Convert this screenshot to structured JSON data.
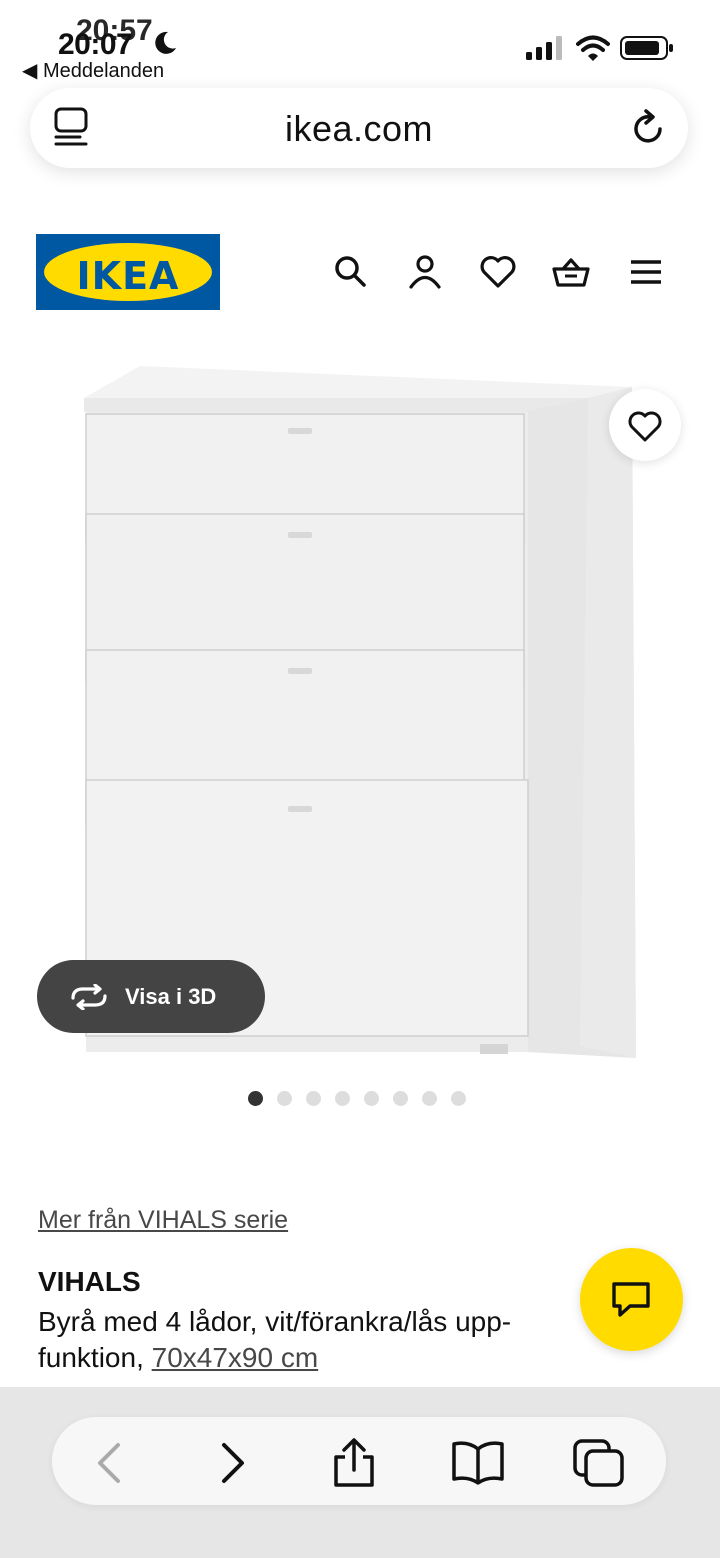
{
  "status_bar": {
    "time": "20:07",
    "time_overlap": "20:57",
    "back_app": "◀ Meddelanden"
  },
  "browser": {
    "url": "ikea.com"
  },
  "product": {
    "view_3d_label": "Visa i 3D",
    "image_count": 8,
    "active_image_index": 0,
    "series_link": "Mer från VIHALS serie",
    "name": "VIHALS",
    "description": "Byrå med 4 lådor, vit/förankra/lås upp-funktion, ",
    "dimensions": "70x47x90 cm"
  },
  "logo": {
    "text": "IKEA"
  },
  "colors": {
    "ikea_blue": "#0058a3",
    "ikea_yellow": "#ffdb00"
  },
  "icons": {
    "header": [
      "search-icon",
      "account-icon",
      "heart-icon",
      "basket-icon",
      "menu-icon"
    ],
    "toolbar": [
      "back-icon",
      "forward-icon",
      "share-icon",
      "bookmarks-icon",
      "tabs-icon"
    ]
  }
}
